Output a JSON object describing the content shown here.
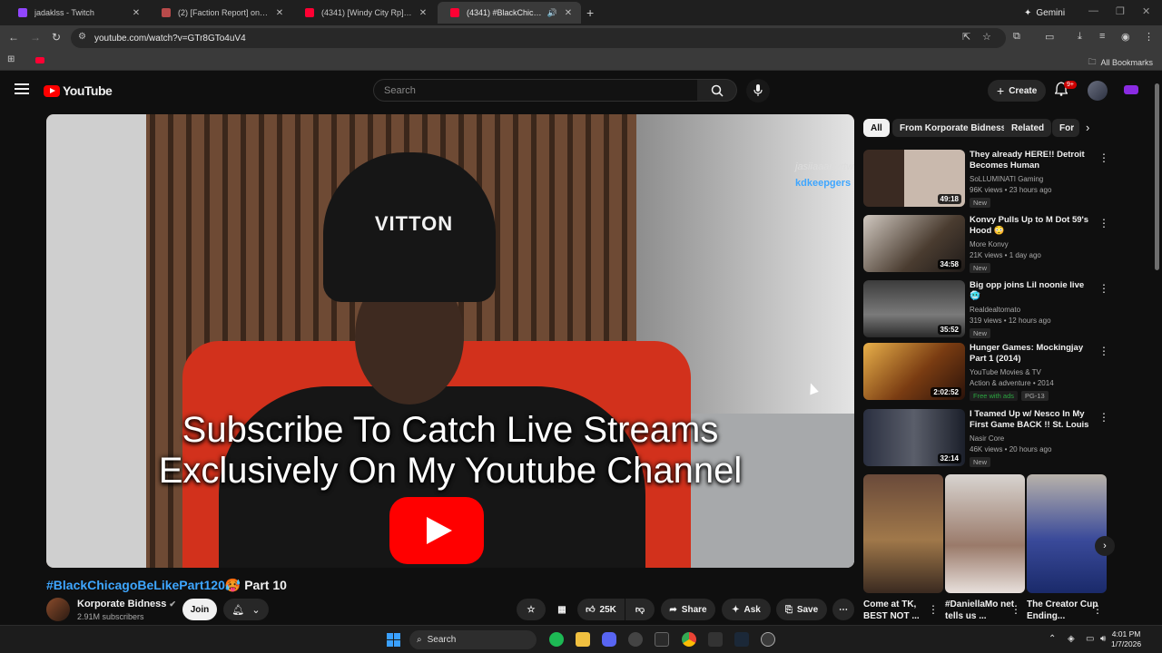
{
  "browser": {
    "tabs": [
      {
        "title": "jadaklss - Twitch",
        "color": "#9146ff"
      },
      {
        "title": "(2) [Faction Report] on 48lock |",
        "color": "#b84a4a"
      },
      {
        "title": "(4341) [Windy City Rp] sinners",
        "color": "#ff0033"
      },
      {
        "title": "(4341) #BlackChicagoBeLik",
        "color": "#ff0033"
      }
    ],
    "gemini_label": "Gemini",
    "url": "youtube.com/watch?v=GTr8GTo4uV4",
    "all_bookmarks": "All Bookmarks"
  },
  "masthead": {
    "logo_text": "YouTube",
    "search_placeholder": "Search",
    "create_label": "Create",
    "notif_count": "9+"
  },
  "player": {
    "overlay_line1": "Subscribe To Catch Live Streams",
    "overlay_line2": "Exclusively On My Youtube Channel",
    "beanie_text": "VITTON",
    "stream_tag1": "jasiiaaar vrtw",
    "stream_tag2": "kdkeepgers"
  },
  "video": {
    "title_hashtag": "#BlackChicagoBeLikePart120",
    "title_emoji": "🥵",
    "title_rest": " Part 10",
    "channel_name": "Korporate Bidness",
    "subscribers": "2.91M subscribers",
    "join_label": "Join",
    "likes": "25K",
    "share_label": "Share",
    "ask_label": "Ask",
    "save_label": "Save"
  },
  "sidebar": {
    "chips": [
      "All",
      "From Korporate Bidness",
      "Related",
      "For"
    ],
    "recommendations": [
      {
        "title": "They already HERE!! Detroit Becomes Human",
        "channel": "SoLLUMINATI Gaming",
        "views": "96K views • 23 hours ago",
        "duration": "49:18",
        "badges": [
          "New"
        ]
      },
      {
        "title": "Konvy Pulls Up to M Dot 59's Hood 😳",
        "channel": "More Konvy",
        "views": "21K views • 1 day ago",
        "duration": "34:58",
        "badges": [
          "New"
        ]
      },
      {
        "title": "Big opp joins Lil noonie live 🥶",
        "channel": "Realdealtomato",
        "views": "319 views • 12 hours ago",
        "duration": "35:52",
        "badges": [
          "New"
        ]
      },
      {
        "title": "Hunger Games: Mockingjay Part 1 (2014)",
        "channel": "YouTube Movies & TV",
        "views": "Action & adventure • 2014",
        "duration": "2:02:52",
        "badges": [
          "Free with ads",
          "PG-13"
        ]
      },
      {
        "title": "I Teamed Up w/ Nesco In My First Game BACK !! St. Louis ...",
        "channel": "Nasir Core",
        "views": "46K views • 20 hours ago",
        "duration": "32:14",
        "badges": [
          "New"
        ]
      }
    ],
    "shorts": [
      {
        "title": "Come at TK, BEST NOT ..."
      },
      {
        "title": "#DaniellaMo net tells us ..."
      },
      {
        "title": "The Creator Cup Ending..."
      }
    ]
  },
  "taskbar": {
    "search_label": "Search",
    "time": "4:01 PM",
    "date": "1/7/2026"
  }
}
